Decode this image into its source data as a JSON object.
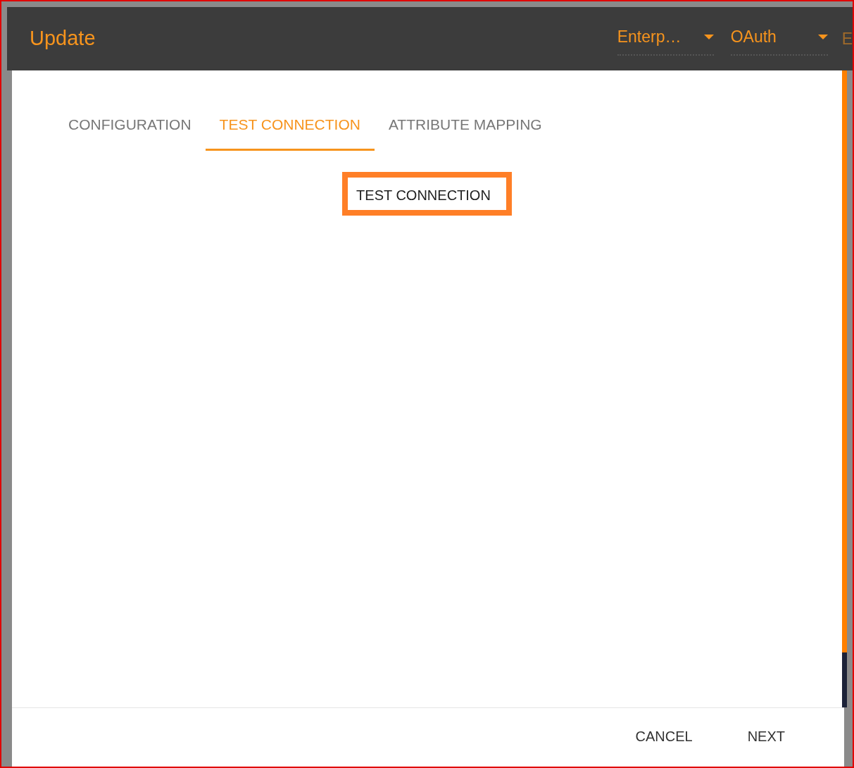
{
  "header": {
    "title": "Update",
    "dropdowns": [
      {
        "value": "Enterp…"
      },
      {
        "value": "OAuth"
      }
    ],
    "cut_item": "E"
  },
  "tabs": [
    {
      "label": "CONFIGURATION",
      "selected": false
    },
    {
      "label": "TEST CONNECTION",
      "selected": true
    },
    {
      "label": "ATTRIBUTE MAPPING",
      "selected": false
    }
  ],
  "action": {
    "label": "TEST CONNECTION",
    "highlighted": true
  },
  "buttons": [
    "CANCEL",
    "NEXT"
  ]
}
